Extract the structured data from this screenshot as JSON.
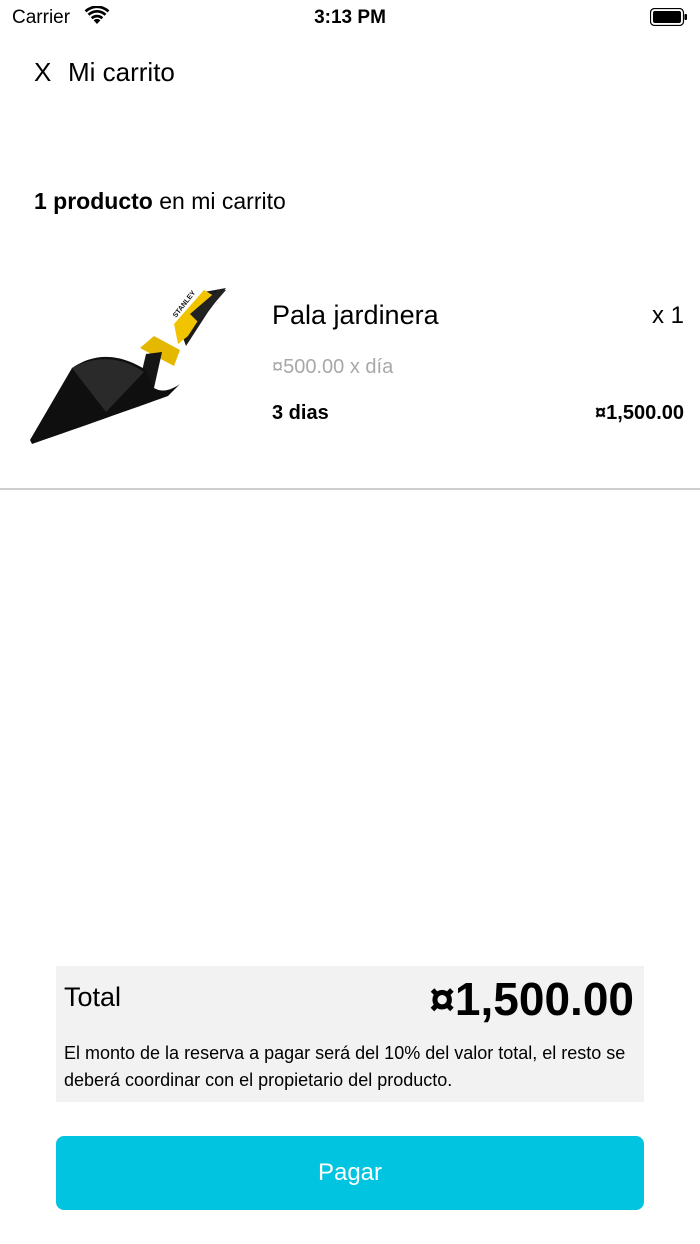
{
  "status_bar": {
    "carrier": "Carrier",
    "time": "3:13 PM"
  },
  "header": {
    "close_label": "X",
    "title": "Mi carrito"
  },
  "cart_summary": {
    "count_bold": "1 producto",
    "count_rest": " en mi carrito"
  },
  "product": {
    "image_icon": "garden-trowel-image",
    "name": "Pala jardinera",
    "quantity": "x 1",
    "unit_price": "¤500.00 x día",
    "days": "3  dias",
    "subtotal": "¤1,500.00"
  },
  "total": {
    "label": "Total",
    "amount": "¤1,500.00",
    "note": "El monto de la reserva a pagar será del 10% del valor total, el resto se deberá coordinar con el propietario del producto."
  },
  "pay_button": {
    "label": "Pagar"
  },
  "colors": {
    "accent": "#00c4e0",
    "total_background": "#f2f2f2",
    "muted_text": "#a8a8a8"
  }
}
